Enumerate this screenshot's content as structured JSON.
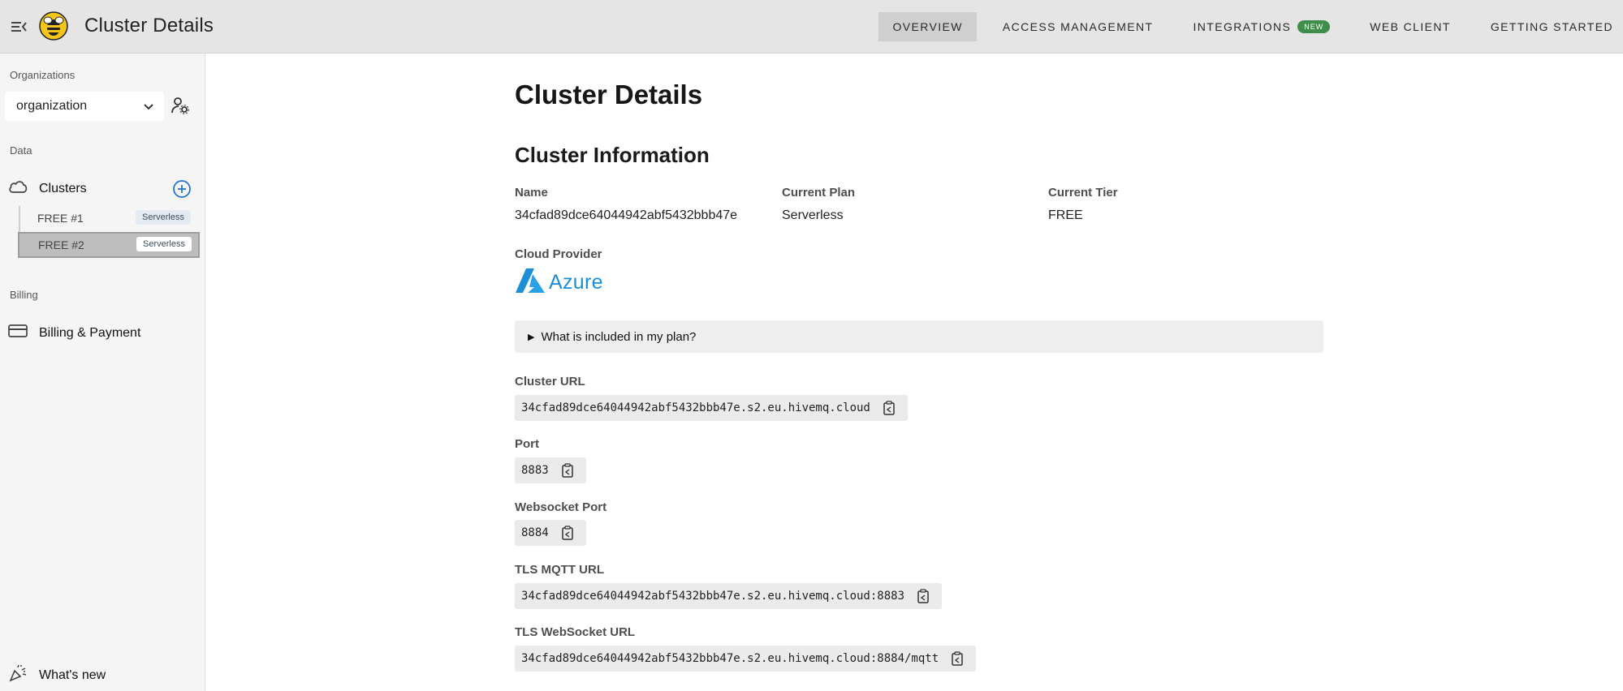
{
  "app": {
    "title": "Cluster Details"
  },
  "nav": {
    "items": [
      {
        "label": "OVERVIEW",
        "active": true
      },
      {
        "label": "ACCESS MANAGEMENT",
        "active": false
      },
      {
        "label": "INTEGRATIONS",
        "active": false,
        "badge": "NEW"
      },
      {
        "label": "WEB CLIENT",
        "active": false
      },
      {
        "label": "GETTING STARTED",
        "active": false
      }
    ]
  },
  "sidebar": {
    "organizations_label": "Organizations",
    "organization_value": "organization",
    "data_label": "Data",
    "clusters_label": "Clusters",
    "clusters": [
      {
        "label": "FREE #1",
        "tag": "Serverless",
        "selected": false
      },
      {
        "label": "FREE #2",
        "tag": "Serverless",
        "selected": true
      }
    ],
    "billing_label": "Billing",
    "billing_item": "Billing & Payment",
    "whats_new": "What's new"
  },
  "main": {
    "page_title": "Cluster Details",
    "section_title": "Cluster Information",
    "name_label": "Name",
    "name_value": "34cfad89dce64044942abf5432bbb47e",
    "plan_label": "Current Plan",
    "plan_value": "Serverless",
    "tier_label": "Current Tier",
    "tier_value": "FREE",
    "provider_label": "Cloud Provider",
    "provider_value": "Azure",
    "plan_details_summary": "What is included in my plan?",
    "cluster_url_label": "Cluster URL",
    "cluster_url_value": "34cfad89dce64044942abf5432bbb47e.s2.eu.hivemq.cloud",
    "port_label": "Port",
    "port_value": "8883",
    "ws_port_label": "Websocket Port",
    "ws_port_value": "8884",
    "tls_mqtt_label": "TLS MQTT URL",
    "tls_mqtt_value": "34cfad89dce64044942abf5432bbb47e.s2.eu.hivemq.cloud:8883",
    "tls_ws_label": "TLS WebSocket URL",
    "tls_ws_value": "34cfad89dce64044942abf5432bbb47e.s2.eu.hivemq.cloud:8884/mqtt"
  },
  "colors": {
    "accent_green": "#3f8f4a",
    "azure_blue": "#1a8fd8",
    "topbar_bg": "#e5e5e5",
    "sidebar_bg": "#f5f5f5"
  },
  "icons": [
    "menu-collapse-icon",
    "bee-logo-icon",
    "chevron-down-icon",
    "user-settings-icon",
    "cloud-icon",
    "add-circle-icon",
    "credit-card-icon",
    "party-popper-icon",
    "copy-icon",
    "azure-logo-icon"
  ]
}
